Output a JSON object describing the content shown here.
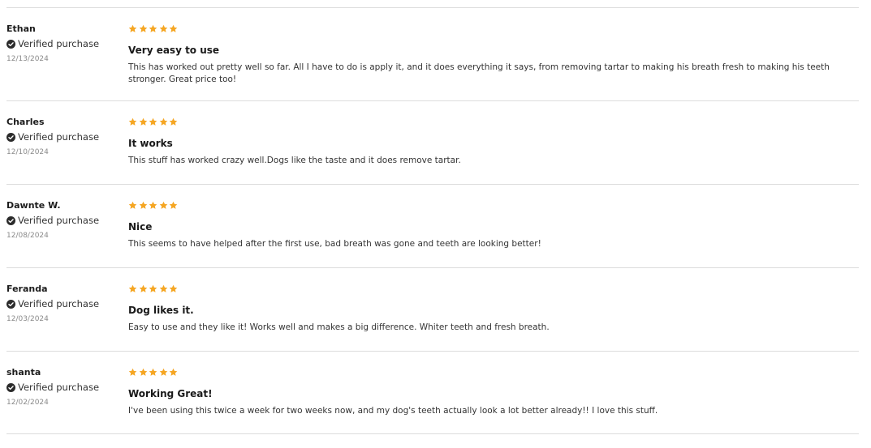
{
  "colors": {
    "star": "#f5a623",
    "divider": "#dcdcdc",
    "check": "#2b2b2b"
  },
  "reviews": [
    {
      "author": "Ethan",
      "verified_label": "Verified purchase",
      "date": "12/13/2024",
      "rating": 5,
      "title": "Very easy to use",
      "body": "This has worked out pretty well so far. All I have to do is apply it, and it does everything it says, from removing tartar to making his breath fresh to making his teeth stronger. Great price too!"
    },
    {
      "author": "Charles",
      "verified_label": "Verified purchase",
      "date": "12/10/2024",
      "rating": 5,
      "title": "It works",
      "body": "This stuff has worked crazy well.Dogs like the taste and it does remove tartar."
    },
    {
      "author": "Dawnte W.",
      "verified_label": "Verified purchase",
      "date": "12/08/2024",
      "rating": 5,
      "title": "Nice",
      "body": "This seems to have helped after the first use, bad breath was gone and teeth are looking better!"
    },
    {
      "author": "Feranda",
      "verified_label": "Verified purchase",
      "date": "12/03/2024",
      "rating": 5,
      "title": "Dog likes it.",
      "body": "Easy to use and they like it! Works well and makes a big difference. Whiter teeth and fresh breath."
    },
    {
      "author": "shanta",
      "verified_label": "Verified purchase",
      "date": "12/02/2024",
      "rating": 5,
      "title": "Working Great!",
      "body": "I've been using this twice a week for two weeks now, and my dog's teeth actually look a lot better already!! I love this stuff."
    }
  ]
}
